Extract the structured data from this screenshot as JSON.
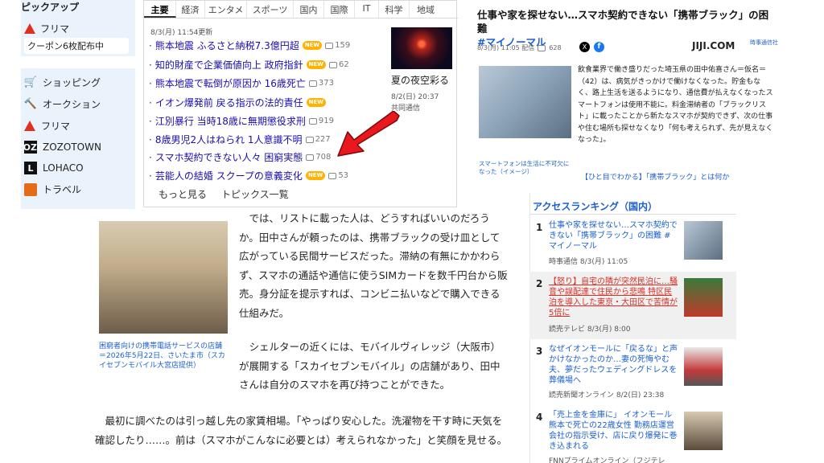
{
  "pickup": {
    "title": "ピックアップ",
    "furima": "フリマ",
    "coupon": "クーポン6枚配布中"
  },
  "services": [
    {
      "label": "ショッピング",
      "icon": "cart-icon"
    },
    {
      "label": "オークション",
      "icon": "hammer-icon"
    },
    {
      "label": "フリマ",
      "icon": "flea-market-icon"
    },
    {
      "label": "ZOZOTOWN",
      "icon": "zozo-icon"
    },
    {
      "label": "LOHACO",
      "icon": "lohaco-icon"
    },
    {
      "label": "トラベル",
      "icon": "suitcase-icon"
    }
  ],
  "news": {
    "tabs": [
      "主要",
      "経済",
      "エンタメ",
      "スポーツ",
      "国内",
      "国際",
      "IT",
      "科学",
      "地域"
    ],
    "updated": "8/3(月) 11:54更新",
    "items": [
      {
        "title": "熊本地震 ふるさと納税7.3億円超",
        "new": "NEW",
        "count": "159"
      },
      {
        "title": "知的財産で企業価値向上 政府指針",
        "new": "NEW",
        "count": "62"
      },
      {
        "title": "熊本地震で転倒が原因か 16歳死亡",
        "new": "",
        "count": "373"
      },
      {
        "title": "イオン爆発前 戻る指示の法的責任",
        "new": "NEW",
        "count": ""
      },
      {
        "title": "江別暴行 当時18歳に無期懲役求刑",
        "new": "",
        "count": "919"
      },
      {
        "title": "8歳男児2人はねられ 1人意識不明",
        "new": "",
        "count": "227"
      },
      {
        "title": "スマホ契約できない人々 困窮実態",
        "new": "",
        "count": "708"
      },
      {
        "title": "芸能人の結婚 スクープの意義変化",
        "new": "NEW",
        "count": "53"
      }
    ],
    "more": "もっと見る",
    "topics": "トピックス一覧",
    "feature_caption": "夏の夜空彩る",
    "feature_date": "8/2(日) 20:37",
    "feature_source": "共同通信"
  },
  "jiji": {
    "title": "仕事や家を探せない…スマホ契約できない「携帯ブラック」の困難",
    "tag": "#マイノーマル",
    "meta_date": "8/3(月) 11:05 配信",
    "meta_count": "628",
    "logo": "JIJI.COM",
    "logo_sub": "時事通信社",
    "photo_caption": "スマートフォンは生活に不可欠になった（イメージ）",
    "body": "飲食業界で働き盛りだった埼玉県の田中佑喜さん＝仮名＝（42）は、病気がきっかけで働けなくなった。貯金もなく、路上生活を送るようになり、通信費が払えなくなったスマートフォンは使用不能に。料金滞納者の「ブラックリスト」に載ったことから新たなスマホが契約できず、次の仕事や住む場所も探せなくなり「何も考えられず、先が見えなくなった」。",
    "link": "【ひと目でわかる】「携帯ブラック」とは何か"
  },
  "ranking": {
    "title": "アクセスランキング（国内）",
    "items": [
      {
        "num": "1",
        "title": "仕事や家を探せない…スマホ契約できない「携帯ブラック」の困難 #マイノーマル",
        "source": "時事通信 8/3(月) 11:05"
      },
      {
        "num": "2",
        "title": "【怒り】自宅の隣が突然民泊に…騒音や誤配達で住民から悲鳴 特区民泊を導入した東京・大田区で苦情が5倍に",
        "source": "読売テレビ 8/3(月) 8:00"
      },
      {
        "num": "3",
        "title": "なぜイオンモールに「戻るな」と声かけなかったのか…妻の死悔やむ夫、夢だったウェディングドレスを葬儀場へ",
        "source": "読売新聞オンライン 8/2(日) 23:38"
      },
      {
        "num": "4",
        "title": "「売上金を金庫に」 イオンモール熊本で死亡の22歳女性 勤務店運営会社の指示受け、店に戻り爆発に巻き込まれる",
        "source": "FNNプライムオンライン（フジテレ"
      }
    ]
  },
  "article": {
    "photo_caption": "困窮者向けの携帯電話サービスの店舗＝2026年5月22日、さいたま市（スカイセブンモバイル大宮店提供）",
    "para1": "では、リストに載った人は、どうすればいいのだろうか。田中さんが頼ったのは、携帯ブラックの受け皿として広がっている民間サービスだった。滞納の有無にかかわらず、スマホの通話や通信に使うSIMカードを数千円台から販売。身分証を提示すれば、コンビニ払いなどで購入できる仕組みだ。",
    "para2": "シェルターの近くには、モバイルヴィレッジ（大阪市）が展開する「スカイセブンモバイル」の店舗があり、田中さんは自分のスマホを再び持つことができた。",
    "para3": "最初に調べたのは引っ越し先の家賃相場。「やっぱり安心した。洗濯物を干す時に天気を確認したり……。前は（スマホがこんなに必要とは）考えられなかった」と笑顔を見せる。"
  },
  "colors": {
    "accent_blue": "#1a5fd0",
    "arrow_red": "#e8181e",
    "new_badge": "#ffb300",
    "pickup_bg": "#eaf2fb"
  }
}
